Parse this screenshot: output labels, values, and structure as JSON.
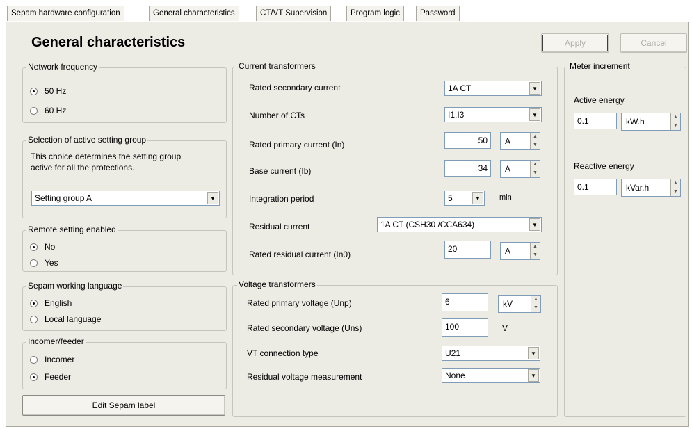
{
  "tabs": [
    {
      "label": "Sepam hardware configuration"
    },
    {
      "label": "General characteristics"
    },
    {
      "label": "CT/VT Supervision"
    },
    {
      "label": "Program logic"
    },
    {
      "label": "Password"
    }
  ],
  "page_title": "General characteristics",
  "buttons": {
    "apply": "Apply",
    "cancel": "Cancel",
    "edit_label": "Edit Sepam label"
  },
  "network_frequency": {
    "title": "Network frequency",
    "options": [
      {
        "label": "50 Hz",
        "selected": true
      },
      {
        "label": "60 Hz",
        "selected": false
      }
    ]
  },
  "setting_group": {
    "title": "Selection of active setting group",
    "description_line1": "This choice determines the setting group",
    "description_line2": "active for all the protections.",
    "value": "Setting group A"
  },
  "remote_setting": {
    "title": "Remote setting enabled",
    "options": [
      {
        "label": "No",
        "selected": true
      },
      {
        "label": "Yes",
        "selected": false
      }
    ]
  },
  "language": {
    "title": "Sepam working language",
    "options": [
      {
        "label": "English",
        "selected": true
      },
      {
        "label": "Local language",
        "selected": false
      }
    ]
  },
  "incomer_feeder": {
    "title": "Incomer/feeder",
    "options": [
      {
        "label": "Incomer",
        "selected": false
      },
      {
        "label": "Feeder",
        "selected": true
      }
    ]
  },
  "current_transformers": {
    "title": "Current transformers",
    "rated_secondary": {
      "label": "Rated secondary current",
      "value": "1A CT"
    },
    "number_of_cts": {
      "label": "Number of CTs",
      "value": "I1,I3"
    },
    "rated_primary": {
      "label": "Rated primary current (In)",
      "value": "50",
      "unit": "A"
    },
    "base_current": {
      "label": "Base current (Ib)",
      "value": "34",
      "unit": "A"
    },
    "integration_period": {
      "label": "Integration period",
      "value": "5",
      "unit": "min"
    },
    "residual_current": {
      "label": "Residual current",
      "value": "1A CT (CSH30 /CCA634)"
    },
    "rated_residual": {
      "label": "Rated residual current (In0)",
      "value": "20",
      "unit": "A"
    }
  },
  "voltage_transformers": {
    "title": "Voltage transformers",
    "rated_primary": {
      "label": "Rated primary voltage (Unp)",
      "value": "6",
      "unit": "kV"
    },
    "rated_secondary": {
      "label": "Rated secondary voltage (Uns)",
      "value": "100",
      "unit": "V"
    },
    "connection_type": {
      "label": "VT connection type",
      "value": "U21"
    },
    "residual_measurement": {
      "label": "Residual voltage measurement",
      "value": "None"
    }
  },
  "meter_increment": {
    "title": "Meter increment",
    "active": {
      "label": "Active energy",
      "value": "0.1",
      "unit": "kW.h"
    },
    "reactive": {
      "label": "Reactive energy",
      "value": "0.1",
      "unit": "kVar.h"
    }
  },
  "icons": {
    "dropdown": "chevron-down-icon",
    "spin_up": "arrow-up-icon",
    "spin_down": "arrow-down-icon"
  }
}
